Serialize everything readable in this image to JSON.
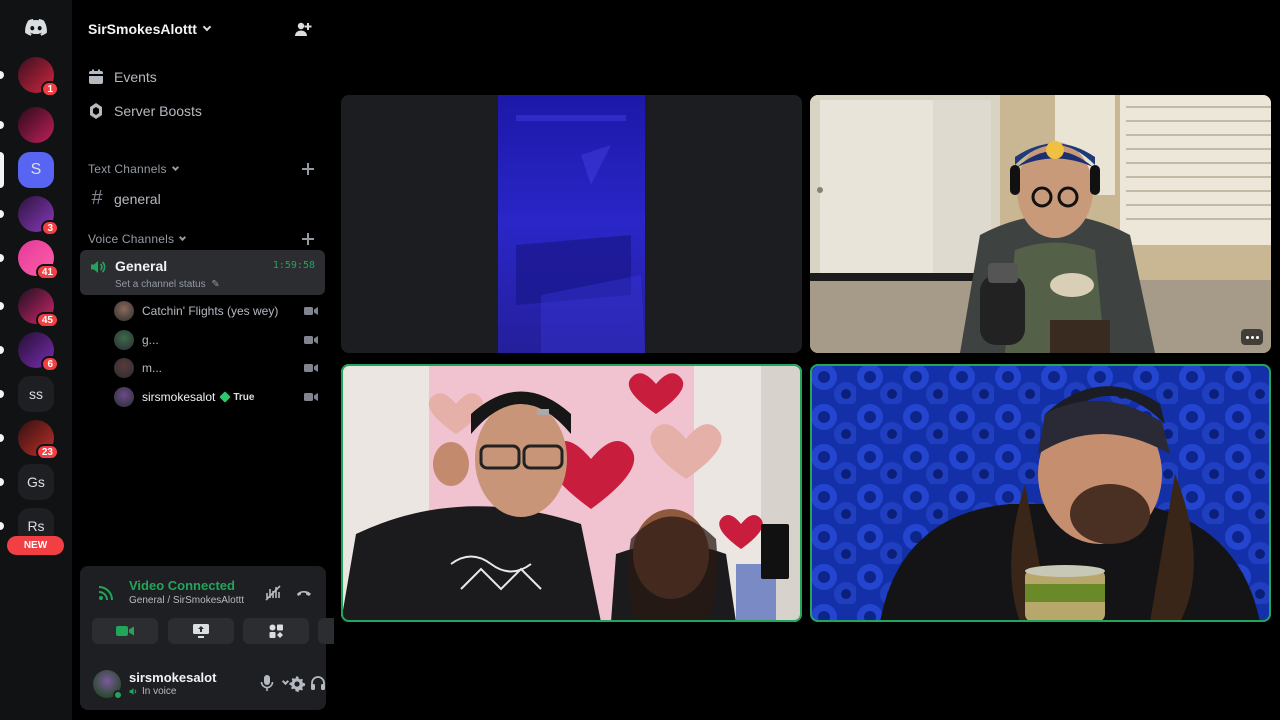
{
  "server": {
    "name": "SirSmokesAlottt"
  },
  "rail": {
    "items": [
      {
        "label": "",
        "badge": "1",
        "colors": [
          "#3a1020",
          "#d0263f"
        ]
      },
      {
        "label": "",
        "badge": "",
        "colors": [
          "#2a0a18",
          "#c0205a"
        ]
      },
      {
        "label": "S",
        "badge": "",
        "colors": [
          "#5865f2",
          "#5865f2"
        ],
        "selected": true
      },
      {
        "label": "",
        "badge": "3",
        "colors": [
          "#2c1340",
          "#8a3ab9"
        ]
      },
      {
        "label": "",
        "badge": "41",
        "colors": [
          "#e33a9a",
          "#ff5fa8"
        ]
      },
      {
        "label": "",
        "badge": "45",
        "colors": [
          "#1d1020",
          "#d0266a"
        ]
      },
      {
        "label": "",
        "badge": "6",
        "colors": [
          "#221033",
          "#7b2cb0"
        ]
      },
      {
        "label": "ss",
        "badge": "",
        "colors": [
          "#1e1f22",
          "#1e1f22"
        ]
      },
      {
        "label": "",
        "badge": "23",
        "colors": [
          "#301010",
          "#c0302a"
        ]
      },
      {
        "label": "Gs",
        "badge": "",
        "colors": [
          "#1e1f22",
          "#1e1f22"
        ]
      },
      {
        "label": "Rs",
        "badge": "",
        "colors": [
          "#1e1f22",
          "#1e1f22"
        ]
      }
    ],
    "new_label": "NEW"
  },
  "nav": {
    "events": "Events",
    "boosts": "Server Boosts"
  },
  "text_category": "Text Channels",
  "text_channels": [
    {
      "name": "general"
    }
  ],
  "voice_category": "Voice Channels",
  "voice_channel": {
    "name": "General",
    "elapsed": "1:59:58",
    "status": "Set a channel status"
  },
  "voice_users": [
    {
      "name": "Catchin' Flights (yes wey)",
      "avatar_color": "#8a6a5a"
    },
    {
      "name": "g...",
      "avatar_color": "#3c6a4a"
    },
    {
      "name": "m...",
      "avatar_color": "#5a3a3a"
    },
    {
      "name": "sirsmokesalot",
      "avatar_color": "#6a4a8a",
      "tag": "True"
    }
  ],
  "connection": {
    "status": "Video Connected",
    "channel": "General / SirSmokesAlottt"
  },
  "user": {
    "name": "sirsmokesalot",
    "status": "In voice"
  },
  "colors": {
    "accent_green": "#23a559",
    "blurple": "#5865f2",
    "badge_red": "#f23f43"
  }
}
